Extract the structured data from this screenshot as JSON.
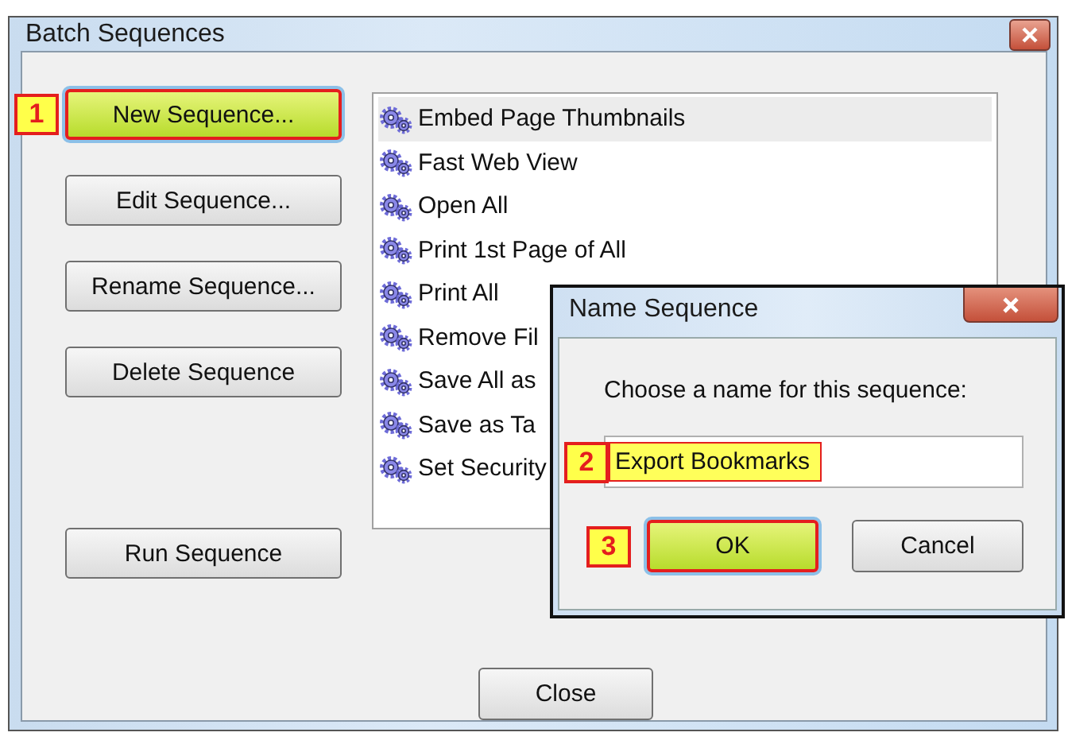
{
  "window": {
    "title": "Batch Sequences"
  },
  "buttons": [
    {
      "label": "New Sequence...",
      "highlighted": true,
      "marker": "1"
    },
    {
      "label": "Edit Sequence...",
      "highlighted": false
    },
    {
      "label": "Rename Sequence...",
      "highlighted": false
    },
    {
      "label": "Delete Sequence",
      "highlighted": false
    },
    {
      "label": "Run Sequence",
      "highlighted": false
    }
  ],
  "sequences": [
    {
      "name": "Embed Page Thumbnails",
      "selected": true
    },
    {
      "name": "Fast Web View",
      "selected": false
    },
    {
      "name": "Open All",
      "selected": false
    },
    {
      "name": "Print 1st Page of All",
      "selected": false
    },
    {
      "name": "Print All",
      "selected": false
    },
    {
      "name": "Remove Fil",
      "selected": false
    },
    {
      "name": "Save All as",
      "selected": false
    },
    {
      "name": "Save as Ta",
      "selected": false
    },
    {
      "name": "Set Security",
      "selected": false
    }
  ],
  "close_button": "Close",
  "dialog": {
    "title": "Name Sequence",
    "prompt": "Choose a name for this sequence:",
    "field": {
      "value": "Export Bookmarks",
      "highlighted": true,
      "marker": "2"
    },
    "buttons": [
      {
        "label": "OK",
        "highlighted": true,
        "marker": "3"
      },
      {
        "label": "Cancel",
        "highlighted": false
      }
    ]
  }
}
